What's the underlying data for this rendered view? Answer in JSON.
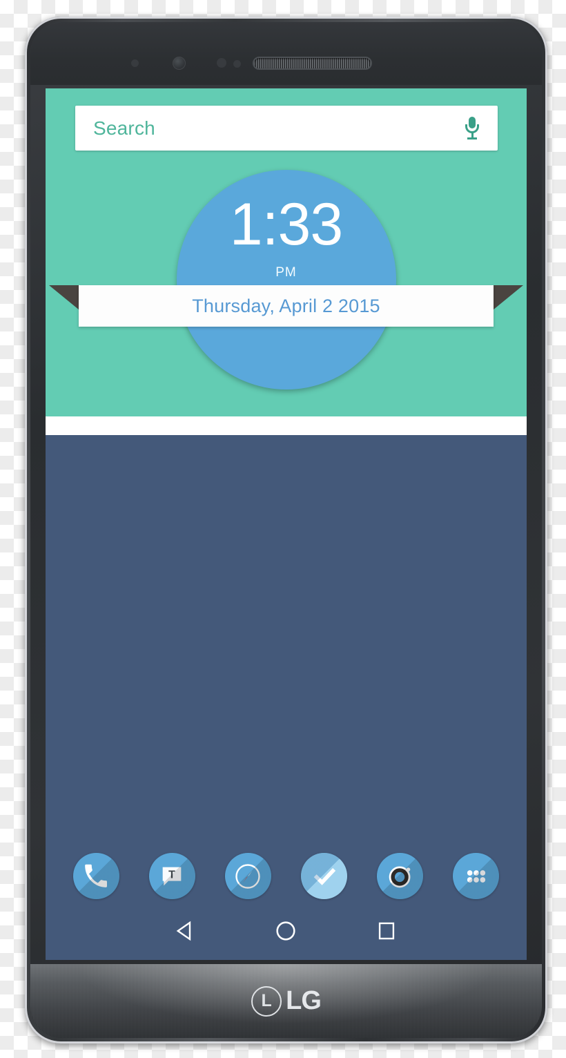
{
  "device": {
    "brand": "LG",
    "logo_mark_letter": "L",
    "logo_wordmark": "LG",
    "bezel_color": "#2c2f32",
    "body_color": "#3b3e42"
  },
  "screen": {
    "wallpaper_top_color": "#63ccb3",
    "wallpaper_bottom_color": "#44597a",
    "divider_band_color": "#ffffff"
  },
  "search": {
    "placeholder": "Search",
    "placeholder_color": "#4fb59b",
    "mic_icon": "microphone-icon",
    "background": "#ffffff"
  },
  "clock_widget": {
    "time": "1:33",
    "meridiem": "PM",
    "date": "Thursday, April 2 2015",
    "circle_color": "#5aa8db",
    "time_color": "#ffffff",
    "date_color": "#5799d3",
    "banner_color": "#fdfdfd",
    "fold_color": "#4a4440"
  },
  "dock": {
    "background_color": "#5ba7d8",
    "items": [
      {
        "name": "phone",
        "icon": "phone-icon",
        "label": "Phone"
      },
      {
        "name": "messaging",
        "icon": "message-bubble-icon",
        "label": "Messaging",
        "glyph_letter": "T"
      },
      {
        "name": "browser",
        "icon": "compass-icon",
        "label": "Browser"
      },
      {
        "name": "tasks",
        "icon": "checkmark-icon",
        "label": "Tasks"
      },
      {
        "name": "camera",
        "icon": "camera-icon",
        "label": "Camera"
      },
      {
        "name": "app-drawer",
        "icon": "app-grid-icon",
        "label": "Apps"
      }
    ]
  },
  "navigation": {
    "background_color": "#44597a",
    "buttons": [
      {
        "name": "back",
        "icon": "back-triangle-icon",
        "label": "Back"
      },
      {
        "name": "home",
        "icon": "home-circle-icon",
        "label": "Home"
      },
      {
        "name": "recents",
        "icon": "recents-square-icon",
        "label": "Recents"
      }
    ]
  }
}
